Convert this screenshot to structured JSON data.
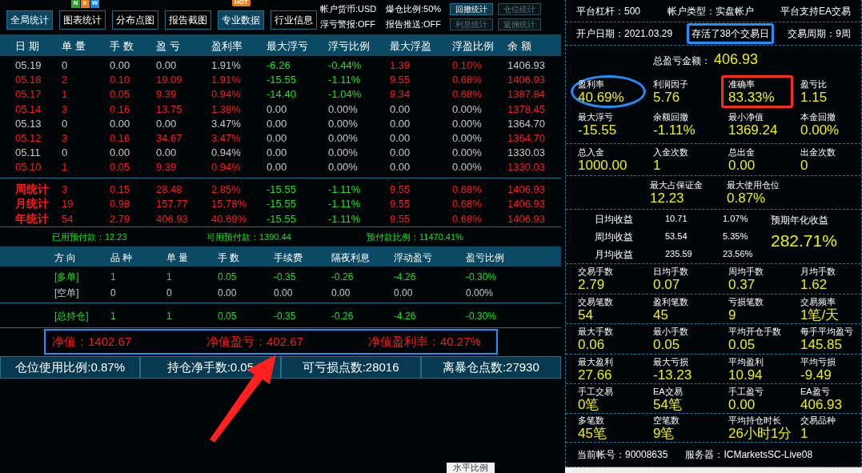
{
  "toolbar": {
    "buttons": [
      {
        "label": "全局统计",
        "selected": true
      },
      {
        "label": "图表统计",
        "selected": false,
        "badge": {
          "kind": "new",
          "letters": [
            "N",
            "E",
            "W"
          ]
        }
      },
      {
        "label": "分布点图",
        "selected": false
      },
      {
        "label": "报告截图",
        "selected": false
      },
      {
        "label": "专业数据",
        "selected": true,
        "badge": {
          "kind": "hot",
          "letters": [
            "HOT"
          ]
        }
      },
      {
        "label": "行业信息",
        "selected": false
      }
    ],
    "info": [
      [
        "帐户货币:USD",
        "爆仓比例:50%"
      ],
      [
        "浮亏警报:OFF",
        "报告推送:OFF"
      ]
    ],
    "small_buttons": [
      [
        {
          "label": "回撤统计",
          "disabled": false
        },
        {
          "label": "仓位统计",
          "disabled": true
        }
      ],
      [
        {
          "label": "利息统计",
          "disabled": true
        },
        {
          "label": "返佣统计",
          "disabled": true
        }
      ]
    ]
  },
  "daily_table": {
    "columns": [
      "日 期",
      "单 量",
      "手 数",
      "盈 亏",
      "盈利率",
      "最大浮亏",
      "浮亏比例",
      "最大浮盈",
      "浮盈比例",
      "余 额"
    ],
    "rows": [
      {
        "cells": [
          {
            "text": "05.19",
            "color": "#c8c8c8"
          },
          {
            "text": "0",
            "color": "#c8c8c8"
          },
          {
            "text": "0.00",
            "color": "#c8c8c8"
          },
          {
            "text": "0.00",
            "color": "#c8c8c8"
          },
          {
            "text": "1.91%",
            "color": "#c8c8c8"
          },
          {
            "text": "-6.26",
            "color": "#19e619"
          },
          {
            "text": "-0.44%",
            "color": "#19e619"
          },
          {
            "text": "1.39",
            "color": "#ff1a1a"
          },
          {
            "text": "0.10%",
            "color": "#ff1a1a"
          },
          {
            "text": "1406.93",
            "color": "#c8c8c8"
          }
        ]
      },
      {
        "cells": [
          {
            "text": "05.18",
            "color": "#ff1a1a"
          },
          {
            "text": "2",
            "color": "#ff1a1a"
          },
          {
            "text": "0.10",
            "color": "#ff1a1a"
          },
          {
            "text": "19.09",
            "color": "#ff1a1a"
          },
          {
            "text": "1.91%",
            "color": "#ff1a1a"
          },
          {
            "text": "-15.55",
            "color": "#19e619"
          },
          {
            "text": "-1.11%",
            "color": "#19e619"
          },
          {
            "text": "9.55",
            "color": "#ff1a1a"
          },
          {
            "text": "0.68%",
            "color": "#ff1a1a"
          },
          {
            "text": "1406.93",
            "color": "#ff1a1a"
          }
        ]
      },
      {
        "cells": [
          {
            "text": "05.17",
            "color": "#ff1a1a"
          },
          {
            "text": "1",
            "color": "#ff1a1a"
          },
          {
            "text": "0.05",
            "color": "#ff1a1a"
          },
          {
            "text": "9.39",
            "color": "#ff1a1a"
          },
          {
            "text": "0.94%",
            "color": "#ff1a1a"
          },
          {
            "text": "-14.40",
            "color": "#19e619"
          },
          {
            "text": "-1.04%",
            "color": "#19e619"
          },
          {
            "text": "9.34",
            "color": "#ff1a1a"
          },
          {
            "text": "0.68%",
            "color": "#ff1a1a"
          },
          {
            "text": "1387.84",
            "color": "#ff1a1a"
          }
        ]
      },
      {
        "cells": [
          {
            "text": "05.14",
            "color": "#ff1a1a"
          },
          {
            "text": "3",
            "color": "#ff1a1a"
          },
          {
            "text": "0.16",
            "color": "#ff1a1a"
          },
          {
            "text": "13.75",
            "color": "#ff1a1a"
          },
          {
            "text": "1.38%",
            "color": "#ff1a1a"
          },
          {
            "text": "0.00",
            "color": "#c8c8c8"
          },
          {
            "text": "0.00%",
            "color": "#c8c8c8"
          },
          {
            "text": "0.00",
            "color": "#c8c8c8"
          },
          {
            "text": "0.00%",
            "color": "#c8c8c8"
          },
          {
            "text": "1378.45",
            "color": "#ff1a1a"
          }
        ]
      },
      {
        "cells": [
          {
            "text": "05.13",
            "color": "#c8c8c8"
          },
          {
            "text": "0",
            "color": "#c8c8c8"
          },
          {
            "text": "0.00",
            "color": "#c8c8c8"
          },
          {
            "text": "0.00",
            "color": "#c8c8c8"
          },
          {
            "text": "3.47%",
            "color": "#c8c8c8"
          },
          {
            "text": "0.00",
            "color": "#c8c8c8"
          },
          {
            "text": "0.00%",
            "color": "#c8c8c8"
          },
          {
            "text": "0.00",
            "color": "#c8c8c8"
          },
          {
            "text": "0.00%",
            "color": "#c8c8c8"
          },
          {
            "text": "1364.70",
            "color": "#c8c8c8"
          }
        ]
      },
      {
        "cells": [
          {
            "text": "05.12",
            "color": "#ff1a1a"
          },
          {
            "text": "3",
            "color": "#ff1a1a"
          },
          {
            "text": "0.16",
            "color": "#ff1a1a"
          },
          {
            "text": "34.67",
            "color": "#ff1a1a"
          },
          {
            "text": "3.47%",
            "color": "#ff1a1a"
          },
          {
            "text": "0.00",
            "color": "#c8c8c8"
          },
          {
            "text": "0.00%",
            "color": "#c8c8c8"
          },
          {
            "text": "0.00",
            "color": "#c8c8c8"
          },
          {
            "text": "0.00%",
            "color": "#c8c8c8"
          },
          {
            "text": "1364.70",
            "color": "#ff1a1a"
          }
        ]
      },
      {
        "cells": [
          {
            "text": "05.11",
            "color": "#c8c8c8"
          },
          {
            "text": "0",
            "color": "#c8c8c8"
          },
          {
            "text": "0.00",
            "color": "#c8c8c8"
          },
          {
            "text": "0.00",
            "color": "#c8c8c8"
          },
          {
            "text": "0.94%",
            "color": "#c8c8c8"
          },
          {
            "text": "0.00",
            "color": "#c8c8c8"
          },
          {
            "text": "0.00%",
            "color": "#c8c8c8"
          },
          {
            "text": "0.00",
            "color": "#c8c8c8"
          },
          {
            "text": "0.00%",
            "color": "#c8c8c8"
          },
          {
            "text": "1330.03",
            "color": "#c8c8c8"
          }
        ]
      },
      {
        "cells": [
          {
            "text": "05.10",
            "color": "#ff1a1a"
          },
          {
            "text": "1",
            "color": "#ff1a1a"
          },
          {
            "text": "0.05",
            "color": "#ff1a1a"
          },
          {
            "text": "9.39",
            "color": "#ff1a1a"
          },
          {
            "text": "0.94%",
            "color": "#ff1a1a"
          },
          {
            "text": "0.00",
            "color": "#c8c8c8"
          },
          {
            "text": "0.00%",
            "color": "#c8c8c8"
          },
          {
            "text": "0.00",
            "color": "#c8c8c8"
          },
          {
            "text": "0.00%",
            "color": "#c8c8c8"
          },
          {
            "text": "1330.03",
            "color": "#ff1a1a"
          }
        ]
      }
    ],
    "summary_rows": [
      {
        "cells": [
          {
            "text": "周统计",
            "color": "#ff1a1a"
          },
          {
            "text": "3",
            "color": "#ff1a1a"
          },
          {
            "text": "0.15",
            "color": "#ff1a1a"
          },
          {
            "text": "28.48",
            "color": "#ff1a1a"
          },
          {
            "text": "2.85%",
            "color": "#ff1a1a"
          },
          {
            "text": "-15.55",
            "color": "#19e619"
          },
          {
            "text": "-1.11%",
            "color": "#19e619"
          },
          {
            "text": "9.55",
            "color": "#ff1a1a"
          },
          {
            "text": "0.68%",
            "color": "#ff1a1a"
          },
          {
            "text": "1406.93",
            "color": "#ff1a1a"
          }
        ]
      },
      {
        "cells": [
          {
            "text": "月统计",
            "color": "#ff1a1a"
          },
          {
            "text": "19",
            "color": "#ff1a1a"
          },
          {
            "text": "0.98",
            "color": "#ff1a1a"
          },
          {
            "text": "157.77",
            "color": "#ff1a1a"
          },
          {
            "text": "15.78%",
            "color": "#ff1a1a"
          },
          {
            "text": "-15.55",
            "color": "#19e619"
          },
          {
            "text": "-1.11%",
            "color": "#19e619"
          },
          {
            "text": "9.55",
            "color": "#ff1a1a"
          },
          {
            "text": "0.68%",
            "color": "#ff1a1a"
          },
          {
            "text": "1406.93",
            "color": "#ff1a1a"
          }
        ]
      },
      {
        "cells": [
          {
            "text": "年统计",
            "color": "#ff1a1a"
          },
          {
            "text": "54",
            "color": "#ff1a1a"
          },
          {
            "text": "2.79",
            "color": "#ff1a1a"
          },
          {
            "text": "406.93",
            "color": "#ff1a1a"
          },
          {
            "text": "40.69%",
            "color": "#ff1a1a"
          },
          {
            "text": "-15.55",
            "color": "#19e619"
          },
          {
            "text": "-1.11%",
            "color": "#19e619"
          },
          {
            "text": "9.55",
            "color": "#ff1a1a"
          },
          {
            "text": "0.68%",
            "color": "#ff1a1a"
          },
          {
            "text": "1406.93",
            "color": "#ff1a1a"
          }
        ]
      }
    ]
  },
  "prepaid": [
    "已用预付款：12.23",
    "可用预付款：1390.44",
    "预付款比例：11470.41%"
  ],
  "positions": {
    "columns": [
      "方 向",
      "品 种",
      "单 量",
      "手 数",
      "手续费",
      "隔夜利息",
      "浮动盈亏",
      "盈亏比例"
    ],
    "rows": [
      {
        "cells": [
          "[多单]",
          "1",
          "1",
          "0.05",
          "-0.35",
          "-0.26",
          "-4.26",
          "-0.30%"
        ],
        "color": "#19e619"
      },
      {
        "cells": [
          "[空单]",
          "0",
          "0",
          "0.00",
          "0.00",
          "0.00",
          "0.00",
          "0.00%"
        ],
        "color": "#c8c8c8"
      }
    ],
    "total": {
      "cells": [
        "[总持仓]",
        "1",
        "1",
        "0.05",
        "-0.35",
        "-0.26",
        "-4.26",
        "-0.30%"
      ],
      "color": "#19e619"
    }
  },
  "net_value": {
    "items": [
      "净值：1402.67",
      "净值盈亏：402.67",
      "净值盈利率：40.27%"
    ],
    "highlight": {
      "kind": "box",
      "color": "#1e90ff"
    }
  },
  "bottom_bar": [
    "仓位使用比例:0.87%",
    "持仓净手数:0.05",
    "可亏损点数:28016",
    "离暴仓点数:27930"
  ],
  "bottom_tab": "水平比例",
  "annotation_arrow": {
    "color": "#ff2020"
  },
  "right_panel": {
    "sections": [
      {
        "kind": "info",
        "items": [
          {
            "text": "平台杠杆：500"
          },
          {
            "text": "帐户类型：实盘帐户"
          },
          {
            "text": "平台支持EA交易"
          }
        ]
      },
      {
        "kind": "info",
        "items": [
          {
            "text": "开户日期：2021.03.29"
          },
          {
            "text": "存活了38个交易日",
            "highlight": {
              "kind": "box",
              "color": "#1e90ff"
            }
          },
          {
            "text": "交易周期：9周"
          }
        ]
      },
      {
        "kind": "stats",
        "total": {
          "label": "总盈亏金额：",
          "value": "406.93"
        },
        "rows": [
          [
            {
              "label": "盈利率",
              "value": "40.69%",
              "highlight": {
                "kind": "ellipse",
                "color": "#1e90ff"
              }
            },
            {
              "label": "利润因子",
              "value": "5.76"
            },
            {
              "label": "准确率",
              "value": "83.33%",
              "highlight": {
                "kind": "box",
                "color": "#ff2a1a"
              }
            },
            {
              "label": "盈亏比",
              "value": "1.15"
            }
          ],
          [
            {
              "label": "最大浮亏",
              "value": "-15.55"
            },
            {
              "label": "余额回撤",
              "value": "-1.11%"
            },
            {
              "label": "最小净值",
              "value": "1369.24"
            },
            {
              "label": "本金回撤",
              "value": "0.00%"
            }
          ]
        ]
      },
      {
        "kind": "stats",
        "rows": [
          [
            {
              "label": "总入金",
              "value": "1000.00"
            },
            {
              "label": "入金次数",
              "value": "1"
            },
            {
              "label": "总出金",
              "value": "0.00"
            },
            {
              "label": "出金次数",
              "value": "0"
            }
          ]
        ]
      },
      {
        "kind": "centered",
        "rows": [
          [
            {
              "label": "最大占保证金",
              "value": "12.23"
            },
            {
              "label": "最大使用仓位",
              "value": "0.87%"
            }
          ]
        ]
      },
      {
        "kind": "returns",
        "rows": [
          [
            "日均收益",
            "10.71",
            "1.07%"
          ],
          [
            "周均收益",
            "53.54",
            "5.35%"
          ],
          [
            "月均收益",
            "235.59",
            "23.56%"
          ]
        ],
        "side": {
          "label": "预期年化收益",
          "value": "282.71%"
        }
      },
      {
        "kind": "stats",
        "rows": [
          [
            {
              "label": "交易手数",
              "value": "2.79"
            },
            {
              "label": "日均手数",
              "value": "0.07"
            },
            {
              "label": "周均手数",
              "value": "0.37"
            },
            {
              "label": "月均手数",
              "value": "1.62"
            }
          ]
        ]
      },
      {
        "kind": "stats",
        "rows": [
          [
            {
              "label": "交易笔数",
              "value": "54"
            },
            {
              "label": "盈利笔数",
              "value": "45"
            },
            {
              "label": "亏损笔数",
              "value": "9"
            },
            {
              "label": "交易频率",
              "value": "1笔/天"
            }
          ]
        ]
      },
      {
        "kind": "stats",
        "rows": [
          [
            {
              "label": "最大手数",
              "value": "0.06"
            },
            {
              "label": "最小手数",
              "value": "0.05"
            },
            {
              "label": "平均开仓手数",
              "value": "0.05"
            },
            {
              "label": "每手平均盈亏",
              "value": "145.85"
            }
          ]
        ]
      },
      {
        "kind": "stats",
        "rows": [
          [
            {
              "label": "最大盈利",
              "value": "27.66"
            },
            {
              "label": "最大亏损",
              "value": "-13.23"
            },
            {
              "label": "平均盈利",
              "value": "10.94"
            },
            {
              "label": "平均亏损",
              "value": "-9.49"
            }
          ]
        ]
      },
      {
        "kind": "stats",
        "rows": [
          [
            {
              "label": "手工交易",
              "value": "0笔"
            },
            {
              "label": "EA交易",
              "value": "54笔"
            },
            {
              "label": "手工盈亏",
              "value": "0.00"
            },
            {
              "label": "EA盈亏",
              "value": "406.93"
            }
          ]
        ]
      },
      {
        "kind": "stats",
        "rows": [
          [
            {
              "label": "多笔数",
              "value": "45笔"
            },
            {
              "label": "空笔数",
              "value": "9笔"
            },
            {
              "label": "平均持仓时长",
              "value": "26小时1分"
            },
            {
              "label": "交易品种",
              "value": "1"
            }
          ]
        ]
      },
      {
        "kind": "footer",
        "items": [
          {
            "text": "当前帐号：90008635"
          },
          {
            "text": "服务器：ICMarketsSC-Live08"
          }
        ]
      }
    ]
  }
}
